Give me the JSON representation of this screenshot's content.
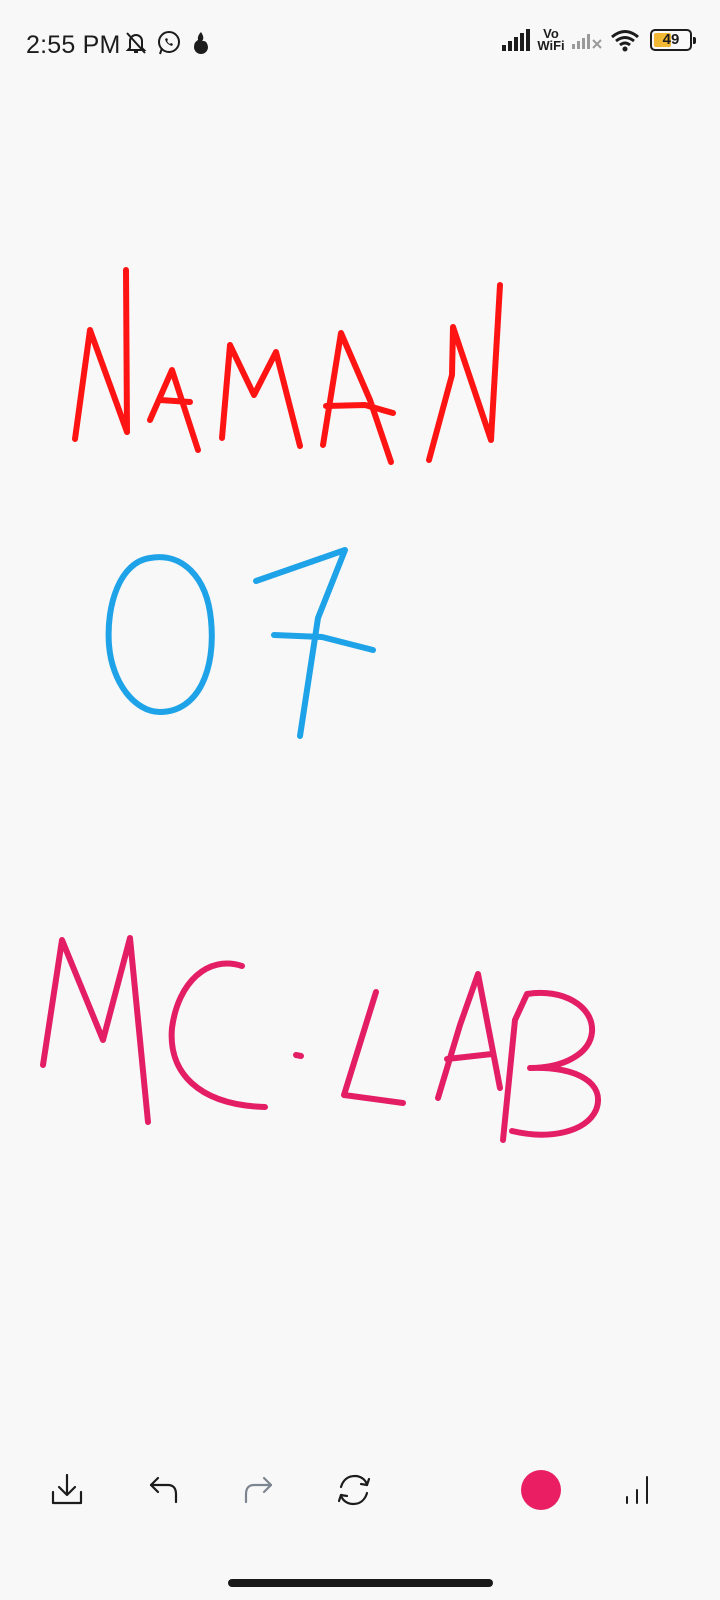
{
  "status_bar": {
    "time": "2:55 PM",
    "left_icons": [
      "notifications-off-icon",
      "whatsapp-icon",
      "fire-icon"
    ],
    "network_label_top": "Vo",
    "network_label_bottom": "WiFi",
    "battery_percent": "49",
    "battery_level": 0.49,
    "battery_color": "#f0b833"
  },
  "canvas": {
    "background": "#f8f8f9",
    "strokes": [
      {
        "text": "NAMAN",
        "color": "#ff1414"
      },
      {
        "text": "07",
        "color": "#1fa3e8"
      },
      {
        "text": "MC·LAB",
        "color": "#e41e64"
      }
    ]
  },
  "toolbar": {
    "tools": [
      {
        "name": "save",
        "icon": "download-icon"
      },
      {
        "name": "undo",
        "icon": "undo-icon"
      },
      {
        "name": "redo",
        "icon": "redo-icon"
      },
      {
        "name": "reset",
        "icon": "refresh-icon"
      },
      {
        "name": "background-color",
        "icon": "color-circle-icon",
        "color": "#f8f8f9"
      },
      {
        "name": "pen-color",
        "icon": "color-circle-icon",
        "color": "#e91e63"
      },
      {
        "name": "stroke-width",
        "icon": "stroke-width-icon"
      }
    ]
  }
}
